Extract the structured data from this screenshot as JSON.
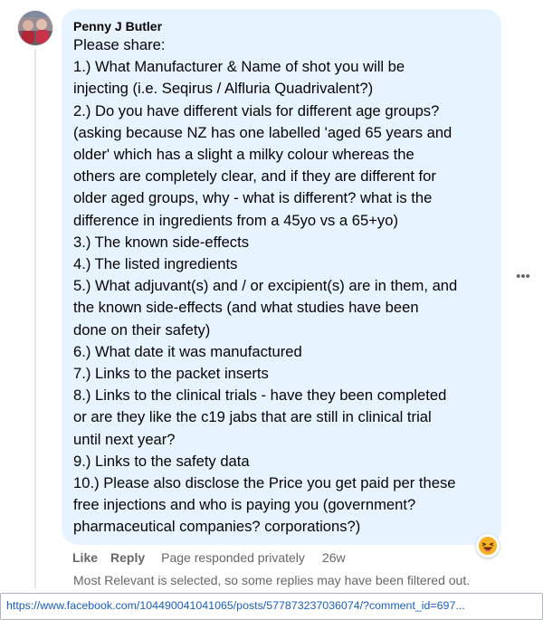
{
  "comment": {
    "author": "Penny J Butler",
    "avatar_icon": "profile-photo",
    "lines": [
      "Please share:",
      "1.) What Manufacturer & Name of shot you will be",
      "injecting (i.e. Seqirus / Alfluria Quadrivalent?)",
      "2.) Do you have different vials for different age groups?",
      "(asking because NZ has one labelled 'aged 65 years and",
      "older' which has a slight a milky colour whereas the",
      "others are completely clear, and if they are different for",
      "older aged groups, why - what is different? what is the",
      "difference in ingredients from a 45yo vs a 65+yo)",
      "3.) The known side-effects",
      "4.) The listed ingredients",
      "5.) What adjuvant(s) and / or excipient(s) are in them, and",
      "the known side-effects (and what studies have been",
      "done on their safety)",
      "6.) What date it was manufactured",
      "7.) Links to the packet inserts",
      "8.) Links to the clinical trials - have they been completed",
      "or are they like the c19 jabs that are still in clinical trial",
      "until next year?",
      "9.) Links to the safety data",
      "10.) Please also disclose the Price you get paid per these",
      "free injections and who is paying you (government?",
      "pharmaceutical companies? corporations?)"
    ],
    "more_label": "•••",
    "reaction_icon": "laughing-emoji-icon"
  },
  "actions": {
    "like": "Like",
    "reply": "Reply",
    "status": "Page responded privately",
    "time": "26w"
  },
  "filter_note": "Most Relevant is selected, so some replies may have been filtered out.",
  "url": "https://www.facebook.com/104490041041065/posts/577873237036074/?comment_id=697..."
}
